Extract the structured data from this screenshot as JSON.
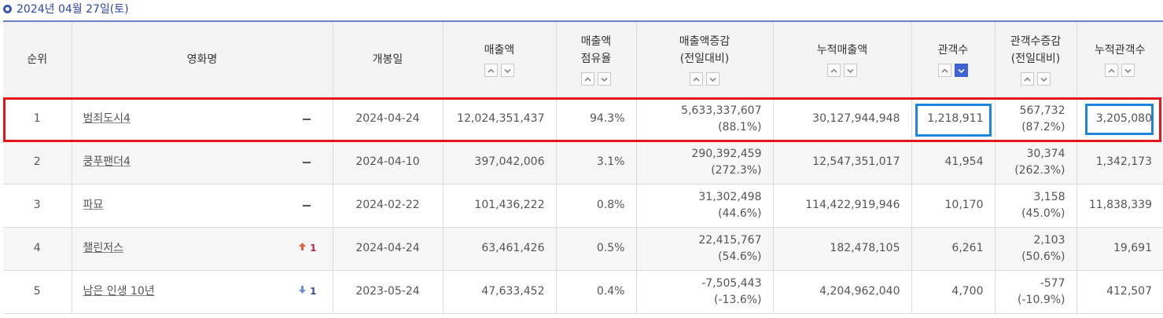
{
  "date_header": "2024년 04월 27일(토)",
  "columns": [
    {
      "label_lines": [
        "순위"
      ],
      "sort": false
    },
    {
      "label_lines": [
        "영화명"
      ],
      "sort": false
    },
    {
      "label_lines": [
        "개봉일"
      ],
      "sort": false
    },
    {
      "label_lines": [
        "매출액"
      ],
      "sort": true,
      "active": false
    },
    {
      "label_lines": [
        "매출액",
        "점유율"
      ],
      "sort": true,
      "active": false
    },
    {
      "label_lines": [
        "매출액증감",
        "(전일대비)"
      ],
      "sort": true,
      "active": false
    },
    {
      "label_lines": [
        "누적매출액"
      ],
      "sort": true,
      "active": false
    },
    {
      "label_lines": [
        "관객수"
      ],
      "sort": true,
      "active": true
    },
    {
      "label_lines": [
        "관객수증감",
        "(전일대비)"
      ],
      "sort": true,
      "active": false
    },
    {
      "label_lines": [
        "누적관객수"
      ],
      "sort": true,
      "active": false
    }
  ],
  "sort_icons": {
    "up": "chevron-up-icon",
    "down": "chevron-down-icon"
  },
  "accent_colors": {
    "highlight_row": "#e8141b",
    "highlight_cell": "#1f86e0",
    "header_rule": "#6e7fc4",
    "active_sort": "#3e63d4"
  },
  "rows": [
    {
      "rank": "1",
      "title": "범죄도시4",
      "change": {
        "type": "none",
        "value": ""
      },
      "open_date": "2024-04-24",
      "sales": "12,024,351,437",
      "share": "94.3%",
      "sales_diff": "5,633,337,607",
      "sales_diff_pct": "(88.1%)",
      "cum_sales": "30,127,944,948",
      "audience": "1,218,911",
      "audience_diff": "567,732",
      "audience_diff_pct": "(87.2%)",
      "cum_audience": "3,205,080"
    },
    {
      "rank": "2",
      "title": "쿵푸팬더4",
      "change": {
        "type": "none",
        "value": ""
      },
      "open_date": "2024-04-10",
      "sales": "397,042,006",
      "share": "3.1%",
      "sales_diff": "290,392,459",
      "sales_diff_pct": "(272.3%)",
      "cum_sales": "12,547,351,017",
      "audience": "41,954",
      "audience_diff": "30,374",
      "audience_diff_pct": "(262.3%)",
      "cum_audience": "1,342,173"
    },
    {
      "rank": "3",
      "title": "파묘",
      "change": {
        "type": "none",
        "value": ""
      },
      "open_date": "2024-02-22",
      "sales": "101,436,222",
      "share": "0.8%",
      "sales_diff": "31,302,498",
      "sales_diff_pct": "(44.6%)",
      "cum_sales": "114,422,919,946",
      "audience": "10,170",
      "audience_diff": "3,158",
      "audience_diff_pct": "(45.0%)",
      "cum_audience": "11,838,339"
    },
    {
      "rank": "4",
      "title": "챌린저스",
      "change": {
        "type": "up",
        "value": "1"
      },
      "open_date": "2024-04-24",
      "sales": "63,461,426",
      "share": "0.5%",
      "sales_diff": "22,415,767",
      "sales_diff_pct": "(54.6%)",
      "cum_sales": "182,478,105",
      "audience": "6,261",
      "audience_diff": "2,103",
      "audience_diff_pct": "(50.6%)",
      "cum_audience": "19,691"
    },
    {
      "rank": "5",
      "title": "남은 인생 10년",
      "change": {
        "type": "down",
        "value": "1"
      },
      "open_date": "2023-05-24",
      "sales": "47,633,452",
      "share": "0.4%",
      "sales_diff": "-7,505,443",
      "sales_diff_pct": "(-13.6%)",
      "cum_sales": "4,204,962,040",
      "audience": "4,700",
      "audience_diff": "-577",
      "audience_diff_pct": "(-10.9%)",
      "cum_audience": "412,507"
    }
  ]
}
